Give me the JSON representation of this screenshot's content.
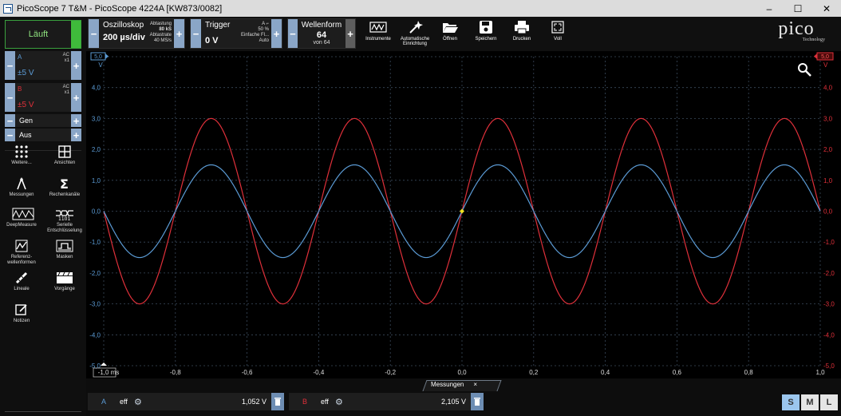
{
  "window": {
    "title": "PicoScope 7 T&M  - PicoScope 4224A [KW873/0082]",
    "minimize": "–",
    "maximize": "☐",
    "close": "✕"
  },
  "toolbar": {
    "run_label": "Läuft",
    "scope": {
      "title": "Oszilloskop",
      "value": "200 µs/div",
      "sampling_label": "Abtastung",
      "sampling_value": "80 kS",
      "rate_label": "Abtastrate",
      "rate_value": "40 MS/s"
    },
    "trigger": {
      "title": "Trigger",
      "value": "0 V",
      "source": "A",
      "level": "50 %",
      "mode": "Einfache Fl...",
      "auto": "Auto"
    },
    "waveform": {
      "title": "Wellenform",
      "value": "64",
      "of": "von 64"
    },
    "buttons": {
      "instruments": "Instrumente",
      "autosetup_line1": "Automatische",
      "autosetup_line2": "Einrichtung",
      "open": "Öffnen",
      "save": "Speichern",
      "print": "Drucken",
      "full": "Voll"
    },
    "logo": "pico",
    "logo_sub": "Technology"
  },
  "channels": {
    "a": {
      "name": "A",
      "range": "±5 V",
      "coupling": "AC",
      "probe": "x1",
      "color": "#5b9bd5"
    },
    "b": {
      "name": "B",
      "range": "±5 V",
      "coupling": "AC",
      "probe": "x1",
      "color": "#e0303a"
    },
    "gen": "Gen",
    "aus": "Aus"
  },
  "tools": [
    {
      "label1": "Weitere...",
      "label2": "",
      "icon": "grid-dots-icon"
    },
    {
      "label1": "Ansichten",
      "label2": "",
      "icon": "views-icon"
    },
    {
      "label1": "Messungen",
      "label2": "",
      "icon": "measure-icon"
    },
    {
      "label1": "Rechenkanäle",
      "label2": "",
      "icon": "sigma-icon"
    },
    {
      "label1": "DeepMeasure",
      "label2": "",
      "icon": "deepmeasure-icon"
    },
    {
      "label1": "Serielle",
      "label2": "Entschlüsselung",
      "icon": "serial-decode-icon"
    },
    {
      "label1": "Referenz-",
      "label2": "wellenformen",
      "icon": "reference-icon"
    },
    {
      "label1": "Masken",
      "label2": "",
      "icon": "masks-icon"
    },
    {
      "label1": "Lineale",
      "label2": "",
      "icon": "ruler-icon"
    },
    {
      "label1": "Vorgänge",
      "label2": "",
      "icon": "actions-icon"
    },
    {
      "label1": "Notizen",
      "label2": "",
      "icon": "notes-icon"
    }
  ],
  "scope_view": {
    "left_axis_unit": "V",
    "right_axis_unit": "V",
    "left_offset_marker": "5,0",
    "right_offset_marker": "5,0",
    "y_ticks": [
      "4,0",
      "3,0",
      "2,0",
      "1,0",
      "0,0",
      "-1,0",
      "-2,0",
      "-3,0",
      "-4,0",
      "-5,0"
    ],
    "x_ticks": [
      "-1,0 ms",
      "-0,8",
      "-0,6",
      "-0,4",
      "-0,2",
      "0,0",
      "0,2",
      "0,4",
      "0,6",
      "0,8",
      "1,0"
    ]
  },
  "chart_data": {
    "type": "line",
    "x_unit": "ms",
    "xlim": [
      -1.0,
      1.0
    ],
    "ylim": [
      -5.0,
      5.0
    ],
    "series": [
      {
        "name": "A",
        "amplitude_v": 1.5,
        "frequency_khz": 2.5,
        "color": "#5b9bd5"
      },
      {
        "name": "B",
        "amplitude_v": 3.0,
        "frequency_khz": 2.5,
        "color": "#e0303a"
      }
    ]
  },
  "measurements": {
    "tab_label": "Messungen",
    "tab_close": "×",
    "rows": [
      {
        "channel": "A",
        "type": "eff",
        "value": "1,052 V",
        "color": "#5b9bd5"
      },
      {
        "channel": "B",
        "type": "eff",
        "value": "2,105 V",
        "color": "#e0303a"
      }
    ]
  },
  "size_buttons": [
    "S",
    "M",
    "L"
  ]
}
